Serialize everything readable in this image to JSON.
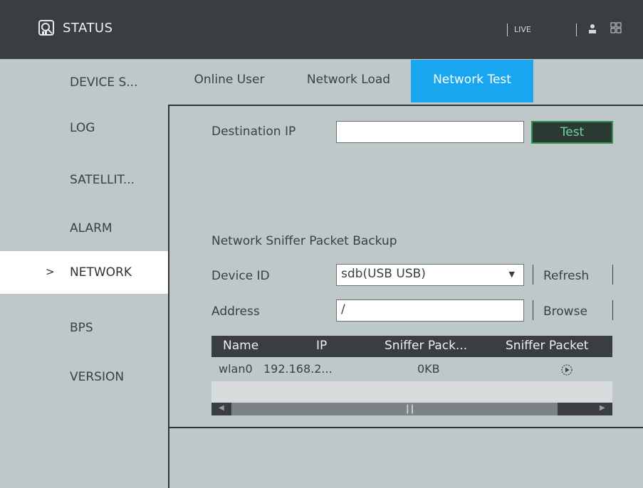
{
  "header": {
    "title": "STATUS",
    "live_label": "LIVE"
  },
  "sidebar": {
    "items": [
      {
        "label": "DEVICE S..."
      },
      {
        "label": "LOG"
      },
      {
        "label": "SATELLIT..."
      },
      {
        "label": "ALARM"
      },
      {
        "label": "NETWORK",
        "active": true,
        "chevron": ">"
      },
      {
        "label": "BPS"
      },
      {
        "label": "VERSION"
      }
    ]
  },
  "tabs": [
    {
      "label": "Online User"
    },
    {
      "label": "Network Load"
    },
    {
      "label": "Network Test",
      "active": true
    }
  ],
  "network_test": {
    "destination_ip_label": "Destination IP",
    "destination_ip_value": "",
    "test_button": "Test"
  },
  "sniffer": {
    "section_title": "Network Sniffer Packet Backup",
    "device_id_label": "Device ID",
    "device_id_value": "sdb(USB USB)",
    "refresh_button": "Refresh",
    "address_label": "Address",
    "address_value": "/",
    "browse_button": "Browse",
    "table": {
      "columns": [
        "Name",
        "IP",
        "Sniffer Pack...",
        "Sniffer Packet"
      ],
      "rows": [
        {
          "name": "wlan0",
          "ip": "192.168.2...",
          "size": "0KB",
          "action_icon": "play-circle-icon"
        }
      ]
    }
  },
  "colors": {
    "background": "#bfc8c8",
    "topbar": "#3a3d42",
    "active_tab": "#19a6f0",
    "test_button_border": "#2f8f53"
  }
}
